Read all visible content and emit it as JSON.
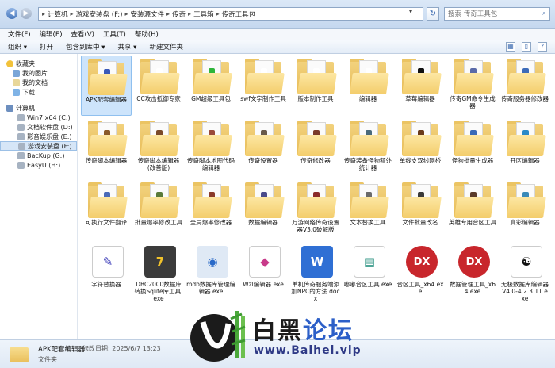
{
  "address": {
    "crumbs": [
      "计算机",
      "游戏安装盘 (F:)",
      "安装源文件",
      "传奇",
      "工具箱",
      "传奇工具包"
    ],
    "search_placeholder": "搜索 传奇工具包"
  },
  "menu": [
    "文件(F)",
    "编辑(E)",
    "查看(V)",
    "工具(T)",
    "帮助(H)"
  ],
  "toolbar": [
    "组织 ▾",
    "打开",
    "包含到库中 ▾",
    "共享 ▾",
    "新建文件夹"
  ],
  "sidebar": {
    "favorites": "收藏夹",
    "fav_items": [
      "我的图片",
      "我的文档",
      "下载"
    ],
    "computer": "计算机",
    "drives": [
      "Win7 x64 (C:)",
      "文档软件盘 (D:)",
      "影音娱乐盘 (E:)",
      "游戏安装盘 (F:)",
      "BacKup (G:)",
      "EasyU (H:)"
    ]
  },
  "files": [
    {
      "name": "APK配套编辑器"
    },
    {
      "name": "CC攻击抵御专家"
    },
    {
      "name": "GM超级工具包"
    },
    {
      "name": "swf文字制作工具"
    },
    {
      "name": "版本制作工具"
    },
    {
      "name": "编辑器"
    },
    {
      "name": "草莓编辑器"
    },
    {
      "name": "传奇GM命令生成器"
    },
    {
      "name": "传奇服务器修改器"
    },
    {
      "name": "传奇脚本编辑器"
    },
    {
      "name": "传奇脚本编辑器(改善版)"
    },
    {
      "name": "传奇脚本地图代码编辑器"
    },
    {
      "name": "传奇设置器"
    },
    {
      "name": "传奇修改器"
    },
    {
      "name": "传奇装备怪物额外统计器"
    },
    {
      "name": "单线支双线网桥"
    },
    {
      "name": "怪物批量生成器"
    },
    {
      "name": "开区编辑器"
    },
    {
      "name": "可执行文件翻译"
    },
    {
      "name": "批量爆率修改工具"
    },
    {
      "name": "全局爆率修改器"
    },
    {
      "name": "数据编辑器"
    },
    {
      "name": "万游网络传奇设置器V3.0破解版"
    },
    {
      "name": "文本替换工具"
    },
    {
      "name": "文件批量改名"
    },
    {
      "name": "英雄专用合区工具"
    },
    {
      "name": "真彩编辑器"
    },
    {
      "name": "字符替换器"
    },
    {
      "name": "DBC2000数据库转换Sqlite库工具.exe"
    },
    {
      "name": "mdb数据库管理编辑器.exe"
    },
    {
      "name": "Wzl编辑器.exe"
    },
    {
      "name": "单机传奇服务端添加NPC的方法.docx"
    },
    {
      "name": "嘟嘟合区工具.exe"
    },
    {
      "name": "合区工具_x64.exe"
    },
    {
      "name": "数据管理工具_x64.exe"
    },
    {
      "name": "无极数据库编辑器V4.0-4.2.3.11.exe"
    }
  ],
  "status": {
    "name": "APK配套编辑器",
    "date": "修改日期: 2025/6/7 13:23",
    "type": "文件夹"
  },
  "watermark": {
    "title_a": "白黑",
    "title_b": "论坛",
    "url": "www.Baihei.vip"
  }
}
